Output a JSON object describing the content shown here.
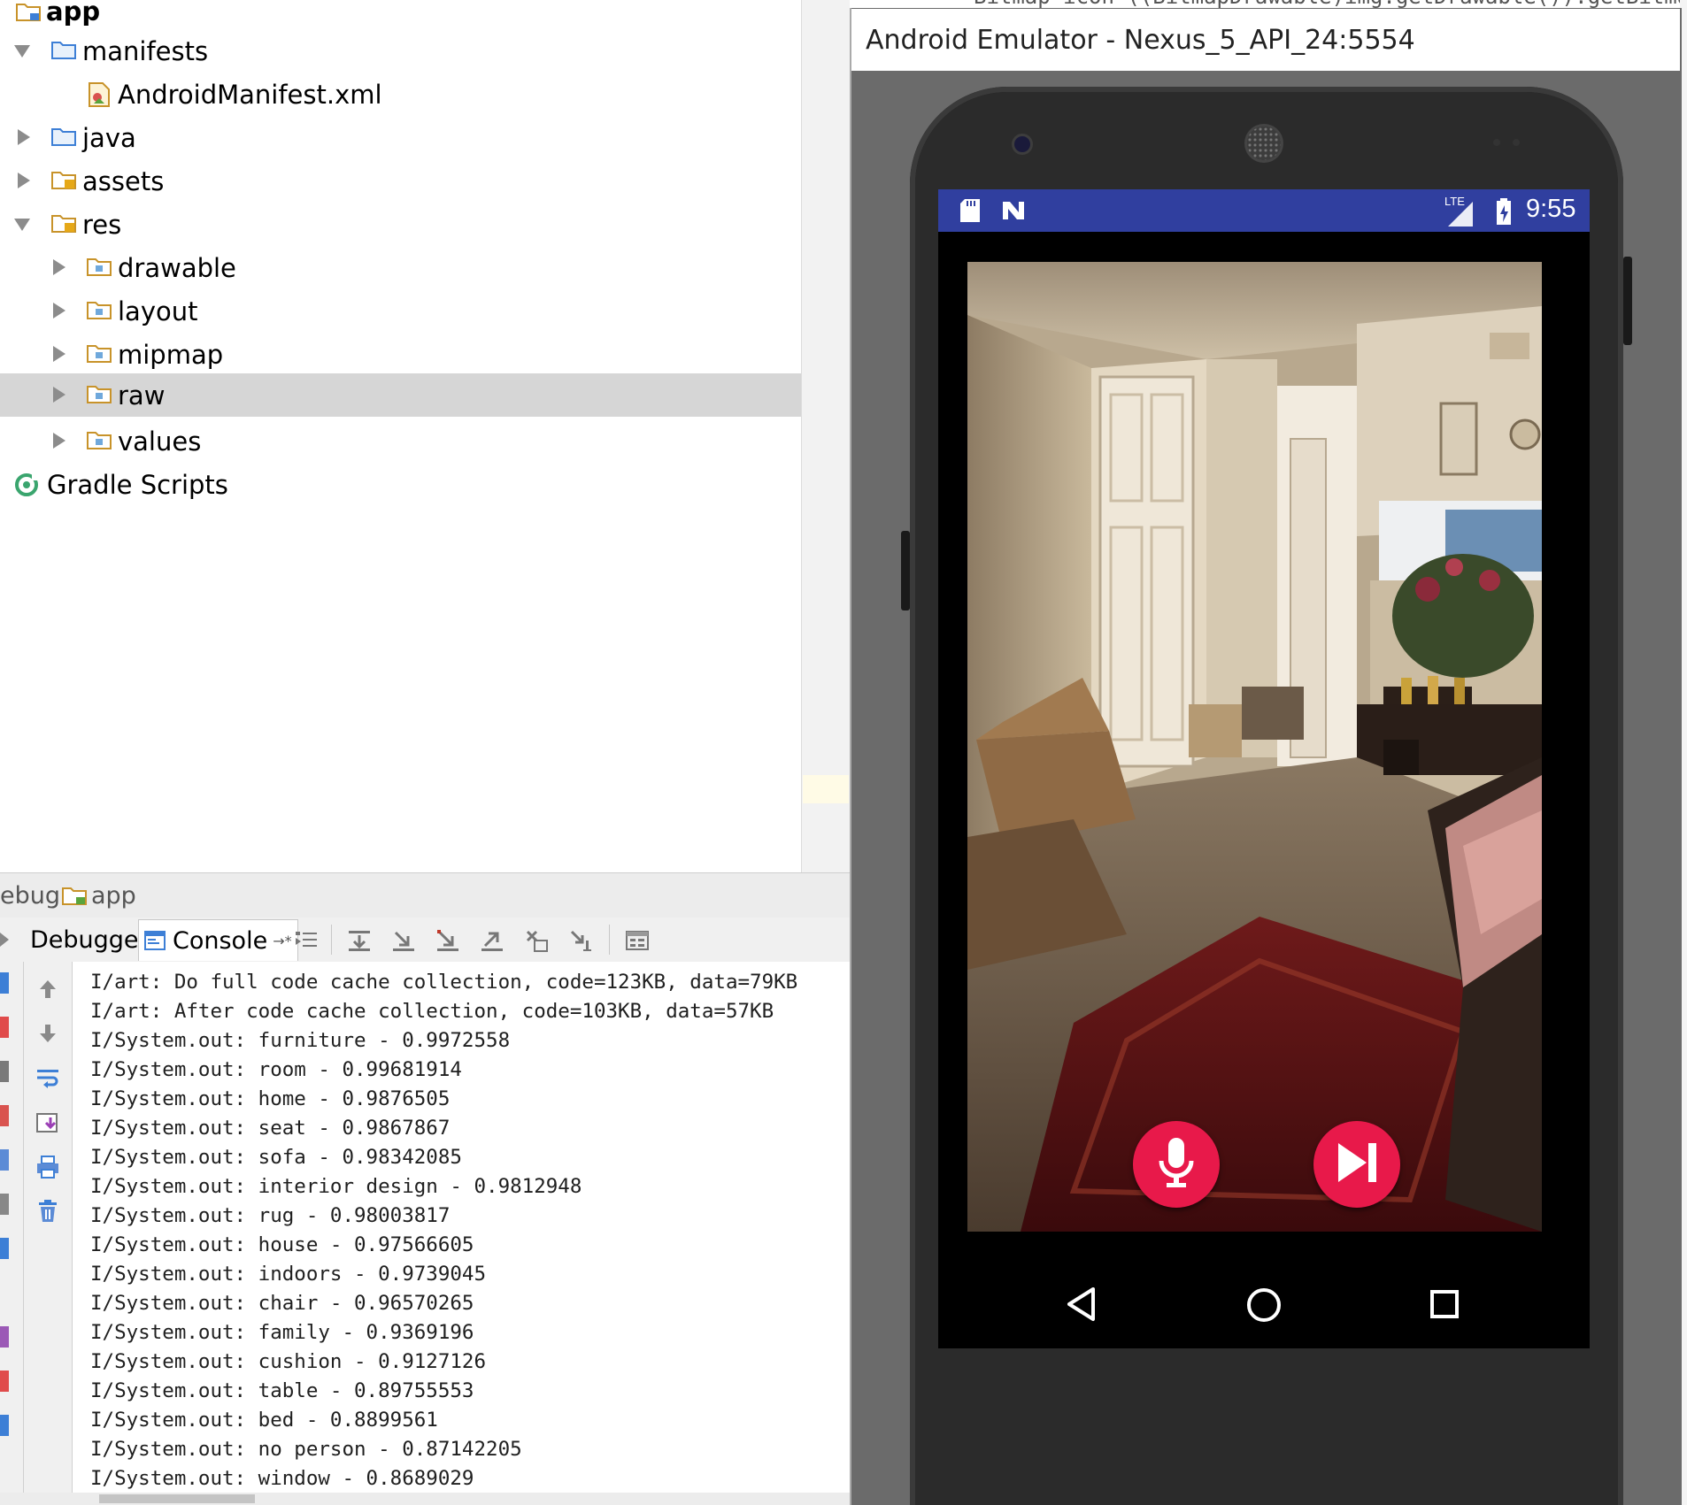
{
  "project_tree": {
    "items": [
      {
        "label": "app",
        "expanded": true
      },
      {
        "label": "manifests",
        "expanded": true
      },
      {
        "label": "AndroidManifest.xml"
      },
      {
        "label": "java",
        "expanded": false
      },
      {
        "label": "assets",
        "expanded": false
      },
      {
        "label": "res",
        "expanded": true
      },
      {
        "label": "drawable",
        "expanded": false
      },
      {
        "label": "layout",
        "expanded": false
      },
      {
        "label": "mipmap",
        "expanded": false
      },
      {
        "label": "raw",
        "expanded": false,
        "selected": true
      },
      {
        "label": "values",
        "expanded": false
      },
      {
        "label": "Gradle Scripts"
      }
    ]
  },
  "debug": {
    "header_prefix": "ebug",
    "config_name": "app",
    "tabs": {
      "debugger": "Debugger",
      "console": "Console",
      "console_suffix": "→*"
    },
    "console_lines": [
      "I/art: Do full code cache collection, code=123KB, data=79KB",
      "I/art: After code cache collection, code=103KB, data=57KB",
      "I/System.out: furniture - 0.9972558",
      "I/System.out: room - 0.99681914",
      "I/System.out: home - 0.9876505",
      "I/System.out: seat - 0.9867867",
      "I/System.out: sofa - 0.98342085",
      "I/System.out: interior design - 0.9812948",
      "I/System.out: rug - 0.98003817",
      "I/System.out: house - 0.97566605",
      "I/System.out: indoors - 0.9739045",
      "I/System.out: chair - 0.96570265",
      "I/System.out: family - 0.9369196",
      "I/System.out: cushion - 0.9127126",
      "I/System.out: table - 0.89755553",
      "I/System.out: bed - 0.8899561",
      "I/System.out: no person - 0.87142205",
      "I/System.out: window - 0.8689029"
    ]
  },
  "editor": {
    "code_fragment": "Bitmap icon=((BitmapDrawable)img.getDrawable()).getBitmap"
  },
  "emulator": {
    "title": "Android Emulator - Nexus_5_API_24:5554",
    "status_bar": {
      "time": "9:55",
      "network": "LTE",
      "color": "#303f9f"
    },
    "buttons": {
      "mic": "mic-icon",
      "next": "skip-next-icon",
      "accent": "#e8194a"
    },
    "nav": [
      "back-icon",
      "home-icon",
      "recents-icon"
    ]
  }
}
